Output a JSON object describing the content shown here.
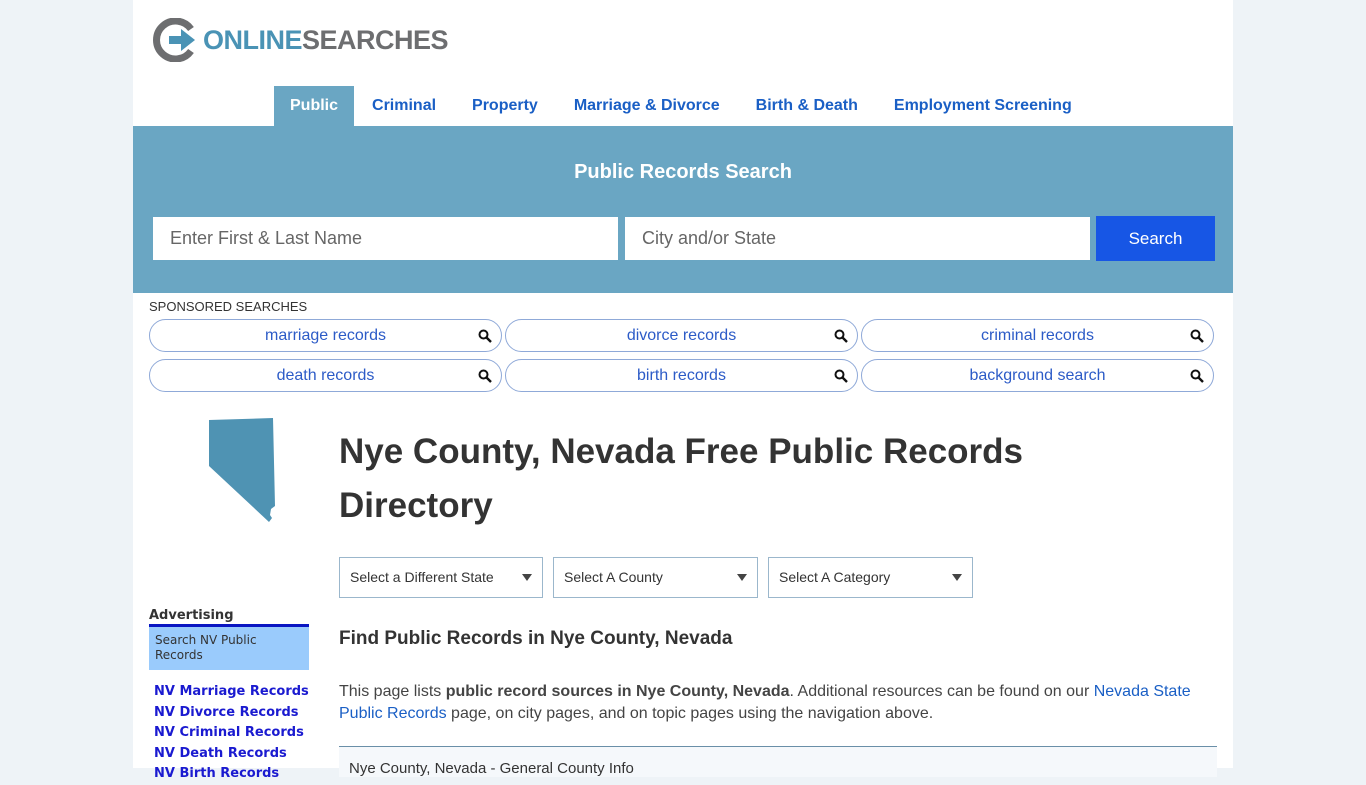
{
  "brand": {
    "word1": "ONLINE",
    "word2": "SEARCHES"
  },
  "nav": [
    {
      "label": "Public",
      "active": true
    },
    {
      "label": "Criminal"
    },
    {
      "label": "Property"
    },
    {
      "label": "Marriage & Divorce"
    },
    {
      "label": "Birth & Death"
    },
    {
      "label": "Employment Screening"
    }
  ],
  "search": {
    "title": "Public Records Search",
    "name_placeholder": "Enter First & Last Name",
    "location_placeholder": "City and/or State",
    "button": "Search"
  },
  "sponsored": {
    "label": "SPONSORED SEARCHES",
    "items": [
      "marriage records",
      "divorce records",
      "criminal records",
      "death records",
      "birth records",
      "background search"
    ]
  },
  "main": {
    "title": "Nye County, Nevada Free Public Records Directory",
    "selects": [
      "Select a Different State",
      "Select A County",
      "Select A Category"
    ],
    "subheading": "Find Public Records in Nye County, Nevada",
    "para_1": "This page lists ",
    "para_bold": "public record sources in Nye County, Nevada",
    "para_2": ". Additional resources can be found on our ",
    "para_link": "Nevada State Public Records",
    "para_3": " page, on city pages, and on topic pages using the navigation above.",
    "info_title": "Nye County, Nevada - General County Info"
  },
  "sidebar": {
    "ads_label": "Advertising",
    "box_text": "Search NV Public Records",
    "links": [
      "NV Marriage Records",
      "NV Divorce Records",
      "NV Criminal Records",
      "NV Death Records",
      "NV Birth Records"
    ]
  },
  "colors": {
    "accent": "#6aa6c3",
    "button": "#1756e5",
    "link": "#1a5fc5"
  }
}
